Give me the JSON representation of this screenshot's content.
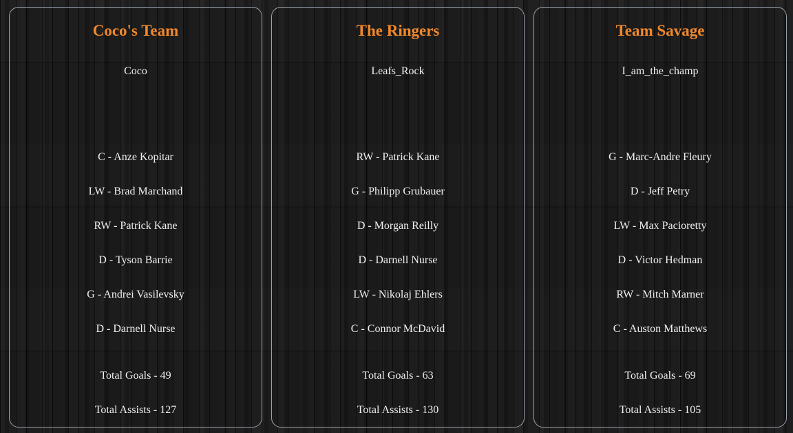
{
  "teams": [
    {
      "name": "Coco's Team",
      "owner": "Coco",
      "players": [
        "C - Anze Kopitar",
        "LW - Brad Marchand",
        "RW - Patrick Kane",
        "D - Tyson Barrie",
        "G - Andrei Vasilevsky",
        "D - Darnell Nurse"
      ],
      "total_goals": "Total Goals - 49",
      "total_assists": "Total Assists - 127"
    },
    {
      "name": "The Ringers",
      "owner": "Leafs_Rock",
      "players": [
        "RW - Patrick Kane",
        "G - Philipp Grubauer",
        "D - Morgan Reilly",
        "D - Darnell Nurse",
        "LW - Nikolaj Ehlers",
        "C - Connor McDavid"
      ],
      "total_goals": "Total Goals - 63",
      "total_assists": "Total Assists - 130"
    },
    {
      "name": "Team Savage",
      "owner": "I_am_the_champ",
      "players": [
        "G - Marc-Andre Fleury",
        "D - Jeff Petry",
        "LW - Max Pacioretty",
        "D - Victor Hedman",
        "RW - Mitch Marner",
        "C - Auston Matthews"
      ],
      "total_goals": "Total Goals - 69",
      "total_assists": "Total Assists - 105"
    }
  ],
  "colors": {
    "team_name": "#f0882d",
    "card_border": "#9aa3ad",
    "text": "#f0f0f0"
  }
}
